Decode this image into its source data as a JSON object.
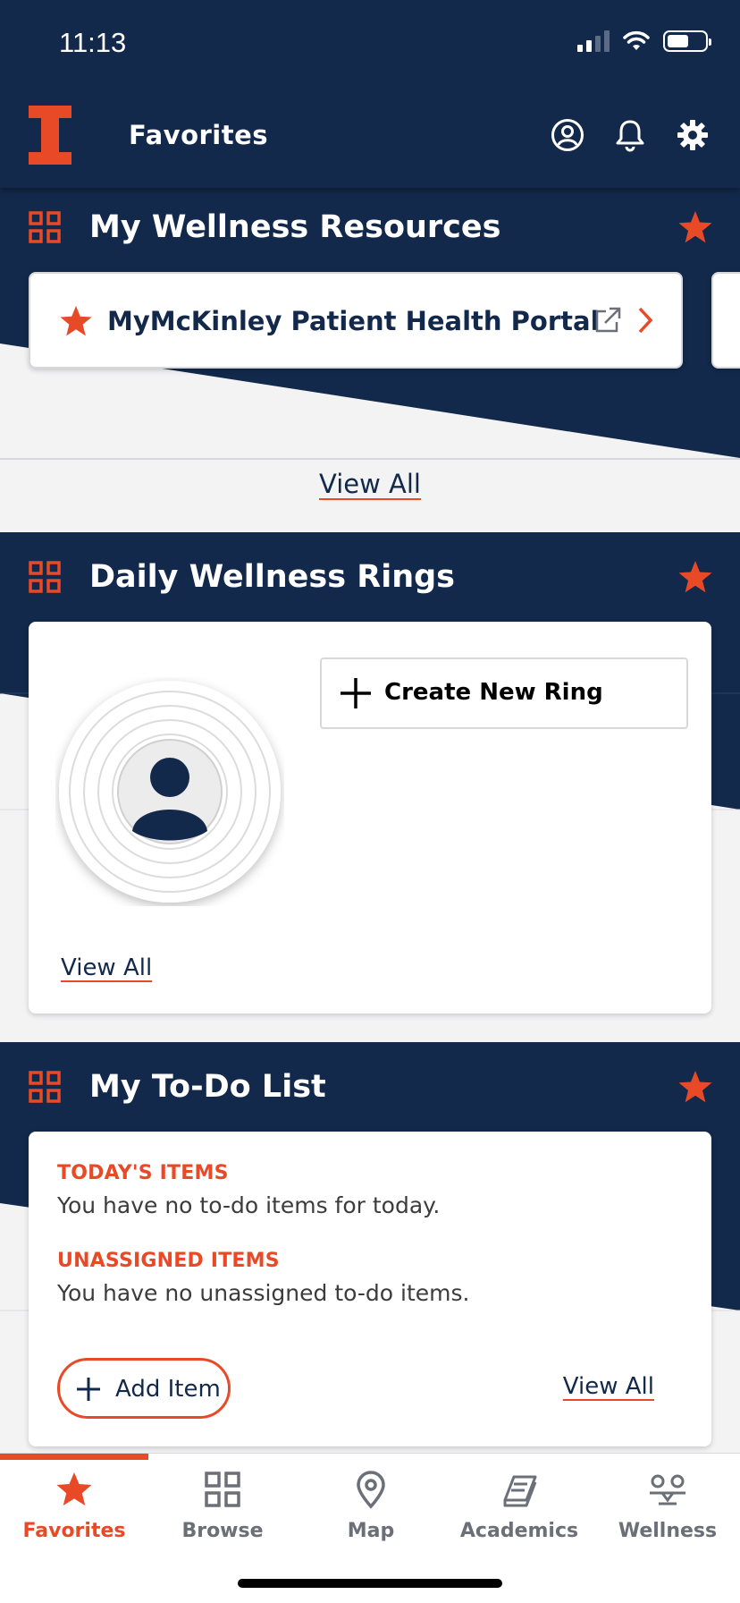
{
  "status_bar": {
    "time": "11:13"
  },
  "header": {
    "title": "Favorites"
  },
  "sections": {
    "wellness_resources": {
      "title": "My Wellness Resources",
      "items": [
        {
          "label": "MyMcKinley Patient Health Portal"
        }
      ],
      "view_all": "View All"
    },
    "wellness_rings": {
      "title": "Daily Wellness Rings",
      "create_label": "Create New Ring",
      "view_all": "View All"
    },
    "todo": {
      "title": "My To-Do List",
      "today_heading": "TODAY'S ITEMS",
      "today_text": "You have no to-do items for today.",
      "unassigned_heading": "UNASSIGNED ITEMS",
      "unassigned_text": "You have no unassigned to-do items.",
      "add_item_label": "Add Item",
      "view_all": "View All"
    }
  },
  "tabs": [
    {
      "label": "Favorites",
      "icon": "star-icon",
      "active": true
    },
    {
      "label": "Browse",
      "icon": "grid-icon",
      "active": false
    },
    {
      "label": "Map",
      "icon": "map-pin-icon",
      "active": false
    },
    {
      "label": "Academics",
      "icon": "books-icon",
      "active": false
    },
    {
      "label": "Wellness",
      "icon": "wellness-icon",
      "active": false
    }
  ],
  "colors": {
    "navy": "#13294b",
    "orange": "#e84a27",
    "light_gray": "#f3f3f4"
  }
}
